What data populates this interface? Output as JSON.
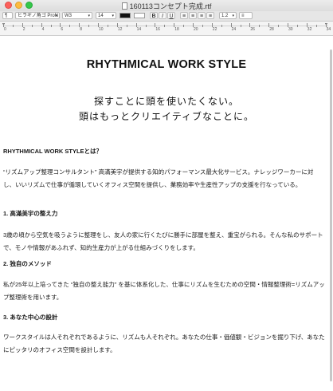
{
  "window": {
    "title": "160113コンセプト完成.rtf"
  },
  "toolbar": {
    "paragraph_style": "¶",
    "font_family": "ヒラギノ角ゴ ProN",
    "font_weight": "W3",
    "font_size": "14",
    "text_color": "#111111",
    "highlight_color": "#ffffff",
    "line_spacing": "1.2",
    "list": "≡"
  },
  "ruler": {
    "numbers": [
      "0",
      "2",
      "4",
      "6",
      "8",
      "10",
      "12",
      "14",
      "16",
      "18",
      "20",
      "22",
      "24",
      "26",
      "28",
      "30",
      "32",
      "34"
    ]
  },
  "document": {
    "heading": "RHYTHMICAL WORK STYLE",
    "tagline_1": "探すことに頭を使いたくない。",
    "tagline_2": "頭はもっとクリエイティブなことに。",
    "section_intro_title": "RHYTHMICAL WORK STYLEとは？",
    "section_intro_body": "“リズムアップ整理コンサルタント” 高滿美宇が提供する知的パフォーマンス最大化サービス。ナレッジワーカーに対し、いいリズムで仕事が循環していくオフィス空間を提供し、業務効率や生産性アップの支援を行なっている。",
    "section_1_title": "1. 高滿美宇の整え力",
    "section_1_body": "3歳の頃から空気を吸うように整理をし、友人の家に行くたびに勝手に部屋を整え、重宝がられる。そんな私のサポートで、モノや情報があふれず、知的生産力が上がる仕組みづくりをします。",
    "section_2_title": "2. 独自のメソッド",
    "section_2_body": "私が25年以上培ってきた “独自の整え能力” を基に体系化した、仕事にリズムを生むための空間・情報整理術=リズムアップ整理術を用います。",
    "section_3_title": "3. あなた中心の設計",
    "section_3_body": "ワークスタイルは人それぞれであるように、リズムも人それぞれ。あなたの仕事・価値観・ビジョンを掘り下げ、あなたにピッタリのオフィス空間を設計します。"
  }
}
